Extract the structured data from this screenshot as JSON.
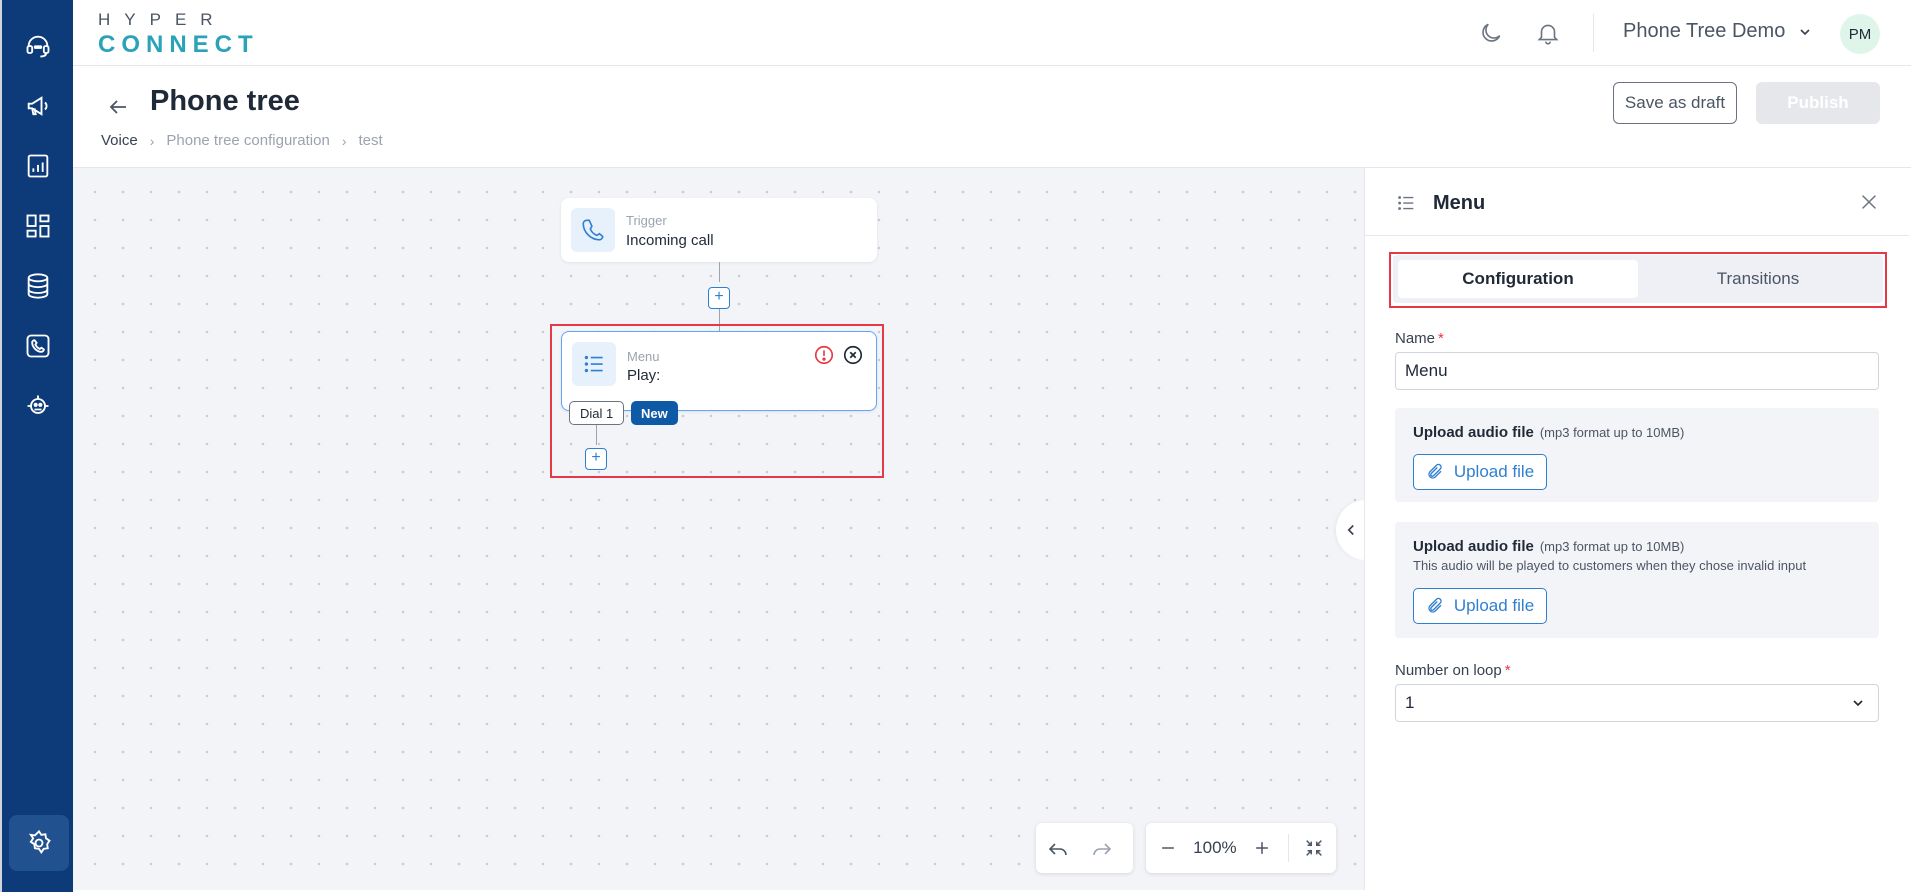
{
  "brand": {
    "logo_top": "HYPER",
    "logo_bottom": "CONNECT"
  },
  "header": {
    "workspace": "Phone Tree Demo",
    "avatar_initials": "PM"
  },
  "page": {
    "title": "Phone tree",
    "breadcrumb": [
      "Voice",
      "Phone tree configuration",
      "test"
    ],
    "save_draft_label": "Save as draft",
    "publish_label": "Publish"
  },
  "canvas": {
    "trigger_node": {
      "label": "Trigger",
      "value": "Incoming call"
    },
    "menu_node": {
      "label": "Menu",
      "value": "Play:"
    },
    "chips": {
      "dial": "Dial 1",
      "new": "New"
    },
    "zoom": "100%"
  },
  "panel": {
    "title": "Menu",
    "tabs": [
      {
        "label": "Configuration",
        "active": true
      },
      {
        "label": "Transitions",
        "active": false
      }
    ],
    "name_label": "Name",
    "name_value": "Menu",
    "uploads": [
      {
        "title": "Upload audio file",
        "hint": "(mp3 format up to 10MB)",
        "desc": "",
        "button": "Upload file"
      },
      {
        "title": "Upload audio file",
        "hint": "(mp3 format up to 10MB)",
        "desc": "This audio will be played to customers when they chose invalid input",
        "button": "Upload file"
      }
    ],
    "loop_label": "Number on loop",
    "loop_value": "1"
  },
  "colors": {
    "sidebar": "#0d3a78",
    "accent": "#2f7fd1",
    "highlight": "#e53945",
    "new_chip": "#0f5aa6"
  }
}
